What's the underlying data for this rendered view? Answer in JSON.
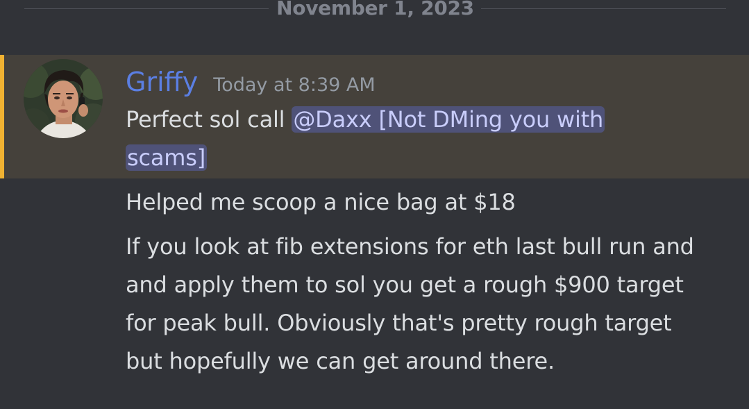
{
  "divider": {
    "date": "November 1, 2023"
  },
  "message": {
    "author": "Griffy",
    "timestamp": "Today at 8:39 AM",
    "avatar_icon": "user-avatar-photo",
    "highlight_color": "#f0b232",
    "username_color": "#5b7fe3",
    "line1_text": "Perfect sol call ",
    "mention_part1": "@Daxx [Not DMing you with",
    "mention_part2": "scams]",
    "line2": "Helped me scoop a nice bag at $18",
    "paragraph_lines": [
      "If you look at fib extensions for eth last bull run and",
      "and apply them to sol you get a rough $900 target",
      "for peak bull. Obviously that's pretty rough target",
      "but hopefully we can get around there."
    ]
  }
}
